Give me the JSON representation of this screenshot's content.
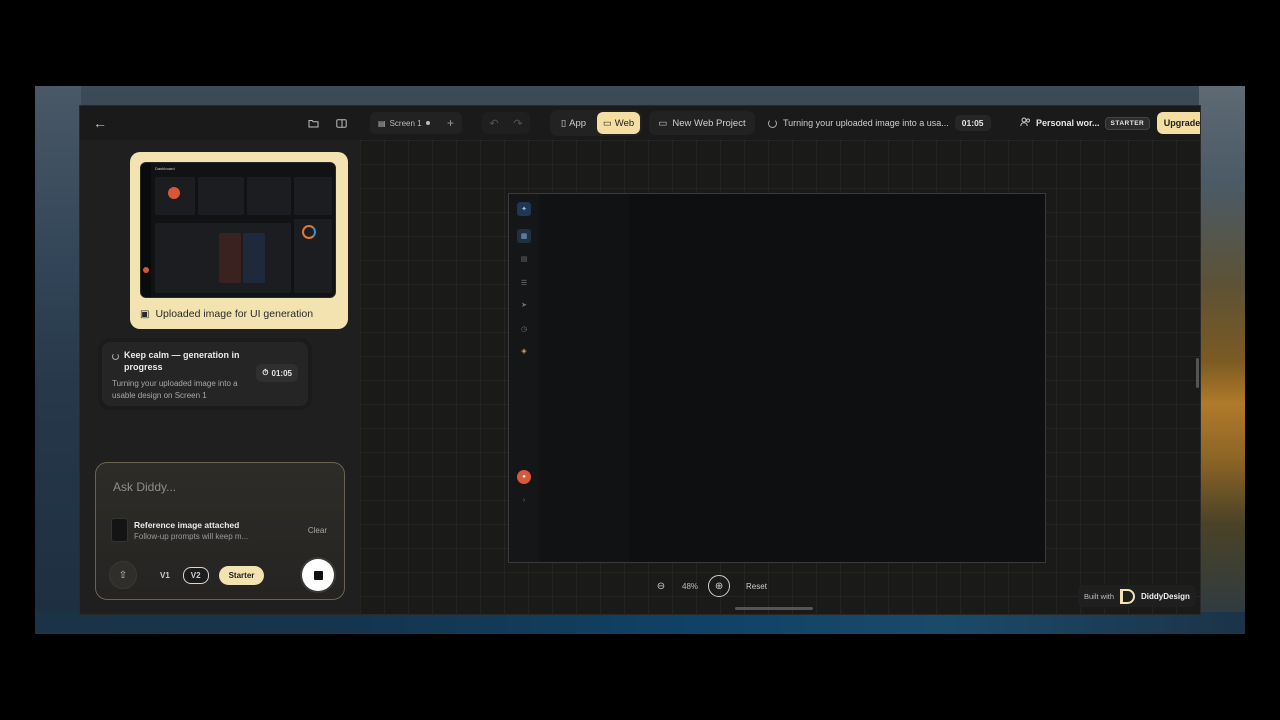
{
  "topbar": {
    "screen_tab": "Screen 1",
    "modes": [
      {
        "label": "App",
        "active": false
      },
      {
        "label": "Web",
        "active": true
      }
    ],
    "project_button": "New Web Project",
    "status_text": "Turning your uploaded image into a usa...",
    "status_timer": "01:05",
    "workspace_name": "Personal wor...",
    "plan_badge": "STARTER",
    "upgrade_label": "Upgrade"
  },
  "chat": {
    "upload_caption": "Uploaded image for UI generation",
    "thumbnail_title": "Dashboard",
    "progress": {
      "title": "Keep calm — generation in progress",
      "body": "Turning your uploaded image into a usable design on Screen 1",
      "timer": "01:05"
    }
  },
  "composer": {
    "placeholder": "Ask Diddy...",
    "reference_title": "Reference image attached",
    "reference_sub": "Follow-up prompts will keep m...",
    "clear_label": "Clear",
    "versions": [
      {
        "label": "V1",
        "active": false
      },
      {
        "label": "V2",
        "active": true
      }
    ],
    "plan_label": "Starter"
  },
  "canvas": {
    "zoom_level": "48%",
    "reset_label": "Reset",
    "built_with": "Built with",
    "brand": "DiddyDesign"
  },
  "colors": {
    "accent": "#f5dea2",
    "avatar": "#d9573b",
    "background": "#171717"
  }
}
